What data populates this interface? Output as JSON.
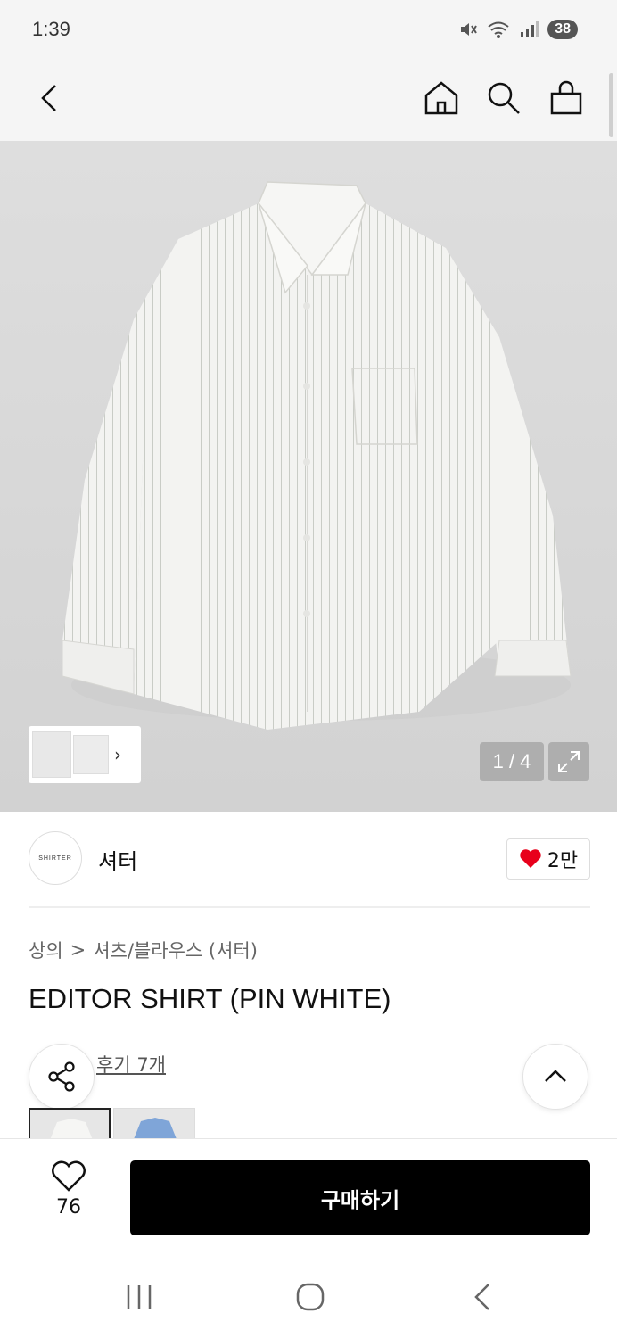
{
  "status_bar": {
    "time": "1:39",
    "battery": "38"
  },
  "top_nav": {
    "icons": [
      "back-icon",
      "home-icon",
      "search-icon",
      "shopping-bag-icon"
    ]
  },
  "gallery": {
    "counter": "1 / 4"
  },
  "brand": {
    "logo_text": "SHIRTER",
    "name": "셔터",
    "likes": "2만"
  },
  "breadcrumb": {
    "category": "상의",
    "separator": ">",
    "subcategory": "셔츠/블라우스 (셔터)"
  },
  "product": {
    "title": "EDITOR SHIRT (PIN WHITE)",
    "reviews": "후기 7개"
  },
  "bottom_bar": {
    "wish_count": "76",
    "buy_label": "구매하기"
  },
  "colors": {
    "accent": "#000000",
    "heart": "#e8001b"
  }
}
